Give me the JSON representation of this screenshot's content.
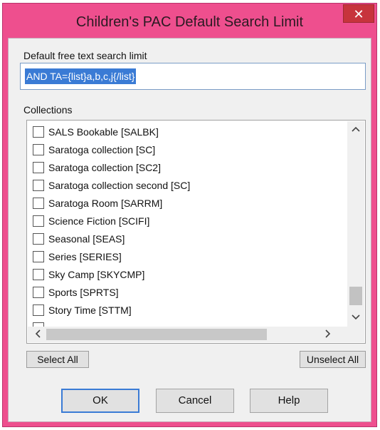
{
  "window": {
    "title": "Children's PAC Default Search Limit",
    "close_glyph": "✕"
  },
  "search": {
    "label": "Default free text search limit",
    "value": "AND TA={list}a,b,c,j{/list}"
  },
  "collections": {
    "label": "Collections",
    "items": [
      {
        "label": "SALS Bookable [SALBK]",
        "checked": false
      },
      {
        "label": "Saratoga collection [SC]",
        "checked": false
      },
      {
        "label": "Saratoga collection [SC2]",
        "checked": false
      },
      {
        "label": "Saratoga collection second [SC]",
        "checked": false
      },
      {
        "label": "Saratoga Room [SARRM]",
        "checked": false
      },
      {
        "label": "Science Fiction [SCIFI]",
        "checked": false
      },
      {
        "label": "Seasonal [SEAS]",
        "checked": false
      },
      {
        "label": "Series [SERIES]",
        "checked": false
      },
      {
        "label": "Sky Camp [SKYCMP]",
        "checked": false
      },
      {
        "label": "Sports [SPRTS]",
        "checked": false
      },
      {
        "label": "Story Time [STTM]",
        "checked": false
      }
    ],
    "icons": {
      "scroll_up": "chevron-up-icon",
      "scroll_down": "chevron-down-icon",
      "scroll_left": "chevron-left-icon",
      "scroll_right": "chevron-right-icon"
    }
  },
  "buttons": {
    "select_all": "Select All",
    "unselect_all": "Unselect All",
    "ok": "OK",
    "cancel": "Cancel",
    "help": "Help"
  },
  "colors": {
    "titlebar": "#ee4f8e",
    "close_button": "#c7343c",
    "selection": "#3a7bd5"
  }
}
